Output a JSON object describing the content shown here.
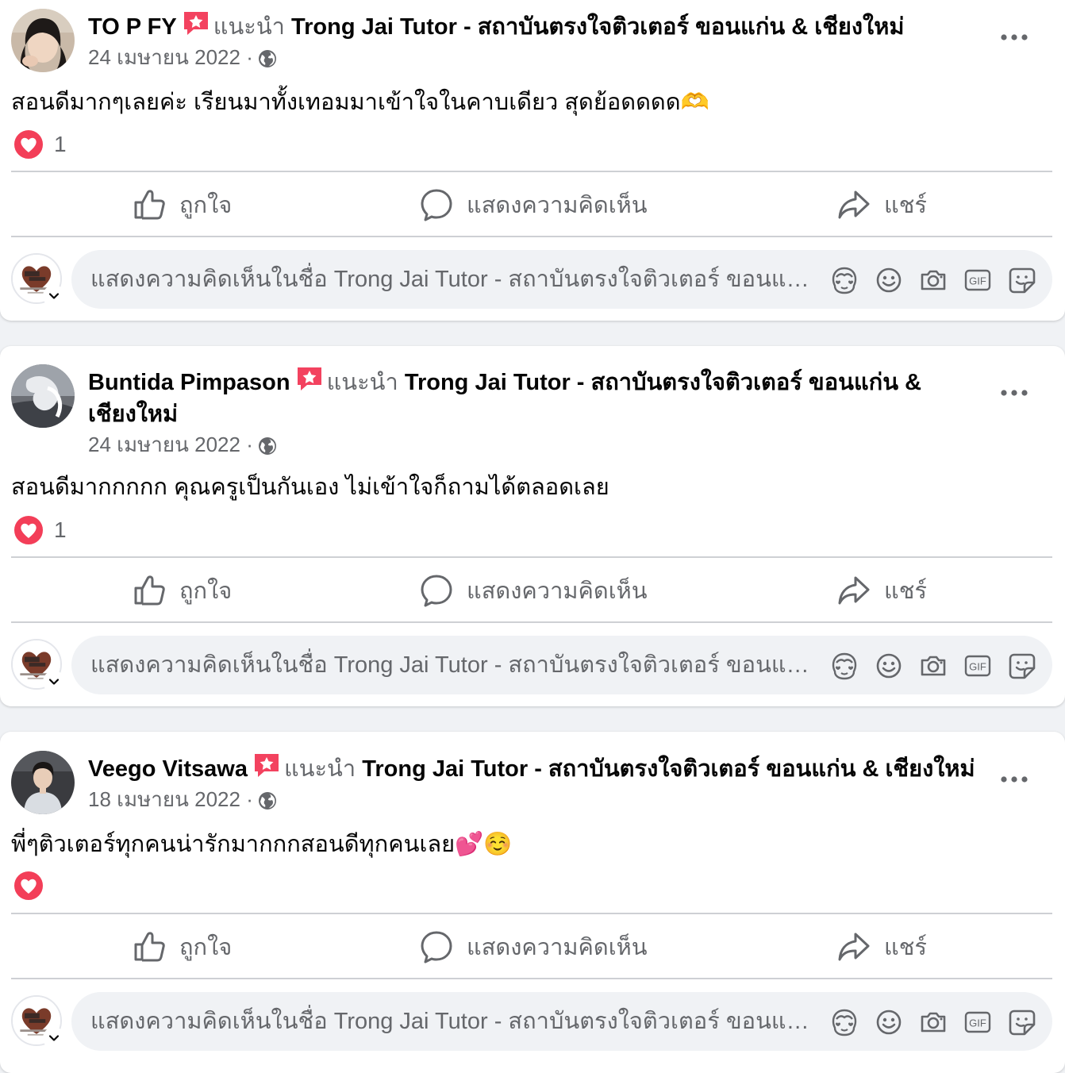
{
  "posts": [
    {
      "author": "TO P FY",
      "recommends": "แนะนำ",
      "page": "Trong Jai Tutor - สถาบันตรงใจติวเตอร์ ขอนแก่น & เชียงใหม่",
      "date": "24 เมษายน 2022 ·",
      "text": "สอนดีมากๆเลยค่ะ เรียนมาทั้งเทอมมาเข้าใจในคาบเดียว สุดย้อดดดด🫶",
      "reaction_count": "1"
    },
    {
      "author": "Buntida Pimpason",
      "recommends": "แนะนำ",
      "page": "Trong Jai Tutor - สถาบันตรงใจติวเตอร์ ขอนแก่น & เชียงใหม่",
      "date": "24 เมษายน 2022 ·",
      "text": "สอนดีมากกกกก คุณครูเป็นกันเอง ไม่เข้าใจก็ถามได้ตลอดเลย",
      "reaction_count": "1"
    },
    {
      "author": "Veego Vitsawa",
      "recommends": "แนะนำ",
      "page": "Trong Jai Tutor - สถาบันตรงใจติวเตอร์ ขอนแก่น & เชียงใหม่",
      "date": "18 เมษายน 2022 ·",
      "text": "พี่ๆติวเตอร์ทุกคนน่ารักมากกกสอนดีทุกคนเลย💕☺️",
      "reaction_count": ""
    }
  ],
  "actions": {
    "like": "ถูกใจ",
    "comment": "แสดงความคิดเห็น",
    "share": "แชร์"
  },
  "composer": {
    "placeholder": "แสดงความคิดเห็นในชื่อ Trong Jai Tutor - สถาบันตรงใจติวเตอร์ ขอนแก่น & เชียงใหม่",
    "tools": [
      "avatar-sticker-icon",
      "emoji-icon",
      "camera-icon",
      "gif-icon",
      "sticker-icon"
    ]
  },
  "colors": {
    "badge": "#f3425f",
    "love": "#f33e58",
    "secondary_text": "#65676b",
    "divider": "#ced0d4"
  }
}
